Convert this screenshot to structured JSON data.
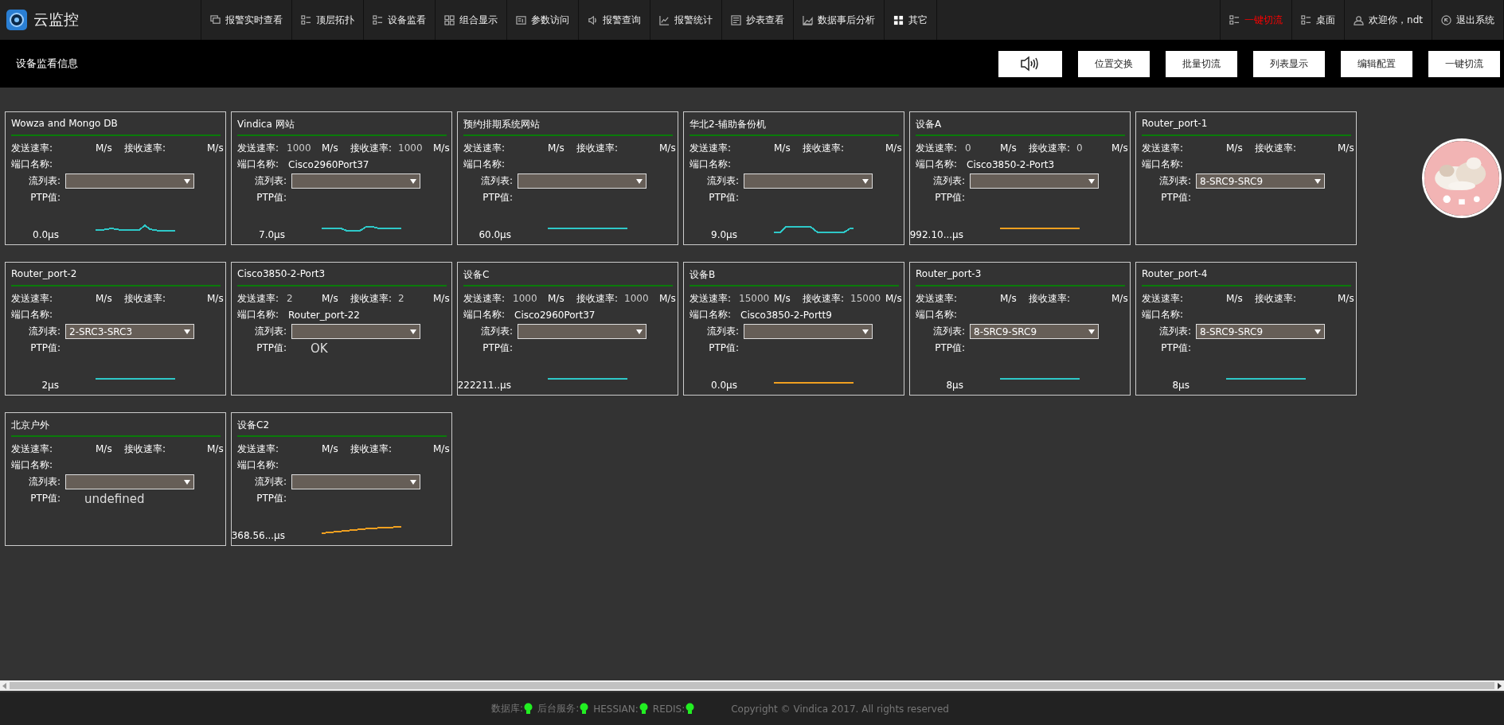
{
  "app": {
    "title": "云监控"
  },
  "nav": [
    {
      "label": "报警实时查看"
    },
    {
      "label": "顶层拓扑"
    },
    {
      "label": "设备监看"
    },
    {
      "label": "组合显示"
    },
    {
      "label": "参数访问"
    },
    {
      "label": "报警查询"
    },
    {
      "label": "报警统计"
    },
    {
      "label": "抄表查看"
    },
    {
      "label": "数据事后分析"
    },
    {
      "label": "其它"
    }
  ],
  "user_nav": [
    {
      "label": "一键切流",
      "alert": true
    },
    {
      "label": "桌面",
      "alert": false
    },
    {
      "label": "欢迎你，ndt",
      "alert": false
    },
    {
      "label": "退出系统",
      "alert": false
    }
  ],
  "header": {
    "title": "设备监看信息",
    "buttons": [
      {
        "label": "位置交换"
      },
      {
        "label": "批量切流"
      },
      {
        "label": "列表显示"
      },
      {
        "label": "编辑配置"
      },
      {
        "label": "一键切流"
      }
    ]
  },
  "cards": [
    {
      "title": "Wowza and Mongo DB",
      "send_label": "发送速率:",
      "send_unit": "M/s",
      "recv_label": "接收速率:",
      "recv_unit": "M/s",
      "port_label": "端口名称:",
      "stream_label": "流列表:",
      "ptp_label": "PTP值:",
      "ptp": "0.0μs",
      "sparkline": {
        "color": "#2ec8c8"
      }
    },
    {
      "title": "Vindica 网站",
      "send_label": "发送速率:",
      "send": "1000",
      "send_unit": "M/s",
      "recv_label": "接收速率:",
      "recv": "1000",
      "recv_unit": "M/s",
      "port_label": "端口名称:",
      "port": "Cisco2960Port37",
      "stream_label": "流列表:",
      "ptp_label": "PTP值:",
      "ptp": "7.0μs",
      "sparkline": {
        "color": "#2ec8c8"
      }
    },
    {
      "title": "预约排期系统网站",
      "send_label": "发送速率:",
      "send_unit": "M/s",
      "recv_label": "接收速率:",
      "recv_unit": "M/s",
      "port_label": "端口名称:",
      "stream_label": "流列表:",
      "ptp_label": "PTP值:",
      "ptp": "60.0μs",
      "sparkline": {
        "color": "#2ec8c8"
      }
    },
    {
      "title": "华北2-辅助备份机",
      "send_label": "发送速率:",
      "send_unit": "M/s",
      "recv_label": "接收速率:",
      "recv_unit": "M/s",
      "port_label": "端口名称:",
      "stream_label": "流列表:",
      "ptp_label": "PTP值:",
      "ptp": "9.0μs",
      "sparkline": {
        "color": "#2ec8c8"
      }
    },
    {
      "title": "设备A",
      "send_label": "发送速率:",
      "send": "0",
      "send_unit": "M/s",
      "recv_label": "接收速率:",
      "recv": "0",
      "recv_unit": "M/s",
      "port_label": "端口名称:",
      "port": "Cisco3850-2-Port3",
      "stream_label": "流列表:",
      "ptp_label": "PTP值:",
      "ptp": "992.10...μs",
      "sparkline": {
        "color": "#f0a020"
      }
    },
    {
      "title": "Router_port-1",
      "send_label": "发送速率:",
      "send_unit": "M/s",
      "recv_label": "接收速率:",
      "recv_unit": "M/s",
      "port_label": "端口名称:",
      "stream_label": "流列表:",
      "stream": "8-SRC9-SRC9",
      "ptp_label": "PTP值:"
    },
    {
      "title": "Router_port-2",
      "send_label": "发送速率:",
      "send_unit": "M/s",
      "recv_label": "接收速率:",
      "recv_unit": "M/s",
      "port_label": "端口名称:",
      "stream_label": "流列表:",
      "stream": "2-SRC3-SRC3",
      "ptp_label": "PTP值:",
      "ptp": "2μs",
      "sparkline": {
        "color": "#2ec8c8"
      }
    },
    {
      "title": "Cisco3850-2-Port3",
      "send_label": "发送速率:",
      "send": "2",
      "send_unit": "M/s",
      "recv_label": "接收速率:",
      "recv": "2",
      "recv_unit": "M/s",
      "port_label": "端口名称:",
      "port": "Router_port-22",
      "stream_label": "流列表:",
      "ptp_label": "PTP值:",
      "ptp_status": "OK"
    },
    {
      "title": "设备C",
      "send_label": "发送速率:",
      "send": "1000",
      "send_unit": "M/s",
      "recv_label": "接收速率:",
      "recv": "1000",
      "recv_unit": "M/s",
      "port_label": "端口名称:",
      "port": "Cisco2960Port37",
      "stream_label": "流列表:",
      "ptp_label": "PTP值:",
      "ptp": "222211..μs",
      "sparkline": {
        "color": "#2ec8c8"
      }
    },
    {
      "title": "设备B",
      "send_label": "发送速率:",
      "send": "15000",
      "send_unit": "M/s",
      "recv_label": "接收速率:",
      "recv": "15000",
      "recv_unit": "M/s",
      "port_label": "端口名称:",
      "port": "Cisco3850-2-Portt9",
      "stream_label": "流列表:",
      "ptp_label": "PTP值:",
      "ptp": "0.0μs",
      "sparkline": {
        "color": "#f0a020"
      }
    },
    {
      "title": "Router_port-3",
      "send_label": "发送速率:",
      "send_unit": "M/s",
      "recv_label": "接收速率:",
      "recv_unit": "M/s",
      "port_label": "端口名称:",
      "stream_label": "流列表:",
      "stream": "8-SRC9-SRC9",
      "ptp_label": "PTP值:",
      "ptp": "8μs",
      "sparkline": {
        "color": "#2ec8c8"
      }
    },
    {
      "title": "Router_port-4",
      "send_label": "发送速率:",
      "send_unit": "M/s",
      "recv_label": "接收速率:",
      "recv_unit": "M/s",
      "port_label": "端口名称:",
      "stream_label": "流列表:",
      "stream": "8-SRC9-SRC9",
      "ptp_label": "PTP值:",
      "ptp": "8μs",
      "sparkline": {
        "color": "#2ec8c8"
      }
    },
    {
      "title": "北京户外",
      "send_label": "发送速率:",
      "send_unit": "M/s",
      "recv_label": "接收速率:",
      "recv_unit": "M/s",
      "port_label": "端口名称:",
      "stream_label": "流列表:",
      "ptp_label": "PTP值:",
      "ptp_status": "undefined"
    },
    {
      "title": "设备C2",
      "send_label": "发送速率:",
      "send_unit": "M/s",
      "recv_label": "接收速率:",
      "recv_unit": "M/s",
      "port_label": "端口名称:",
      "stream_label": "流列表:",
      "ptp_label": "PTP值:",
      "ptp": "368.56...μs",
      "sparkline": {
        "color": "#f0a020"
      }
    }
  ],
  "footer": {
    "services": [
      {
        "label": "数据库:",
        "ok": true
      },
      {
        "label": "后台服务:",
        "ok": true
      },
      {
        "label": "HESSIAN:",
        "ok": true
      },
      {
        "label": "REDIS:",
        "ok": true
      }
    ],
    "copyright": "Copyright © Vindica 2017. All rights reserved"
  }
}
